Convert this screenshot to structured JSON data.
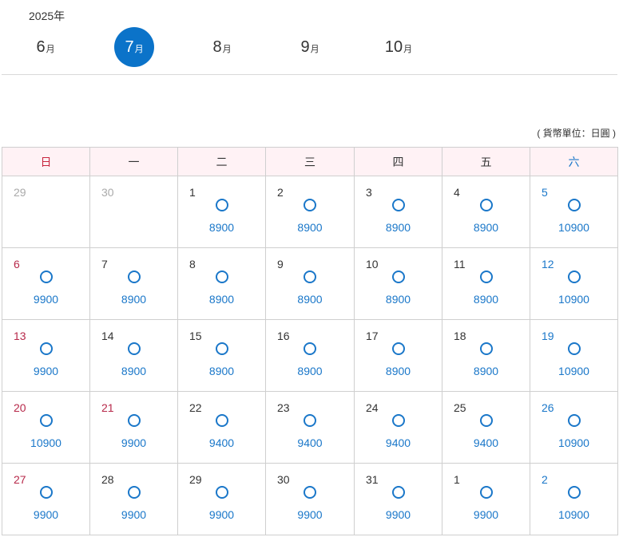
{
  "year_label": "2025年",
  "months": [
    {
      "num": "6",
      "unit": "月",
      "active": false
    },
    {
      "num": "7",
      "unit": "月",
      "active": true
    },
    {
      "num": "8",
      "unit": "月",
      "active": false
    },
    {
      "num": "9",
      "unit": "月",
      "active": false
    },
    {
      "num": "10",
      "unit": "月",
      "active": false
    }
  ],
  "currency_note": "( 貨幣單位：日圓 )",
  "weekdays": [
    "日",
    "一",
    "二",
    "三",
    "四",
    "五",
    "六"
  ],
  "colors": {
    "accent": "#0b73c9",
    "sunday": "#c8253e",
    "saturday": "#1a77c9",
    "header_bg": "#fff2f5"
  },
  "availability_symbol": "circle-icon",
  "weeks": [
    [
      {
        "day": "29",
        "muted": true
      },
      {
        "day": "30",
        "muted": true
      },
      {
        "day": "1",
        "price": "8900"
      },
      {
        "day": "2",
        "price": "8900"
      },
      {
        "day": "3",
        "price": "8900"
      },
      {
        "day": "4",
        "price": "8900"
      },
      {
        "day": "5",
        "price": "10900"
      }
    ],
    [
      {
        "day": "6",
        "price": "9900"
      },
      {
        "day": "7",
        "price": "8900"
      },
      {
        "day": "8",
        "price": "8900"
      },
      {
        "day": "9",
        "price": "8900"
      },
      {
        "day": "10",
        "price": "8900"
      },
      {
        "day": "11",
        "price": "8900"
      },
      {
        "day": "12",
        "price": "10900"
      }
    ],
    [
      {
        "day": "13",
        "price": "9900"
      },
      {
        "day": "14",
        "price": "8900"
      },
      {
        "day": "15",
        "price": "8900"
      },
      {
        "day": "16",
        "price": "8900"
      },
      {
        "day": "17",
        "price": "8900"
      },
      {
        "day": "18",
        "price": "8900"
      },
      {
        "day": "19",
        "price": "10900"
      }
    ],
    [
      {
        "day": "20",
        "price": "10900"
      },
      {
        "day": "21",
        "price": "9900",
        "holiday": true
      },
      {
        "day": "22",
        "price": "9400"
      },
      {
        "day": "23",
        "price": "9400"
      },
      {
        "day": "24",
        "price": "9400"
      },
      {
        "day": "25",
        "price": "9400"
      },
      {
        "day": "26",
        "price": "10900"
      }
    ],
    [
      {
        "day": "27",
        "price": "9900"
      },
      {
        "day": "28",
        "price": "9900"
      },
      {
        "day": "29",
        "price": "9900"
      },
      {
        "day": "30",
        "price": "9900"
      },
      {
        "day": "31",
        "price": "9900"
      },
      {
        "day": "1",
        "price": "9900"
      },
      {
        "day": "2",
        "price": "10900"
      }
    ]
  ]
}
